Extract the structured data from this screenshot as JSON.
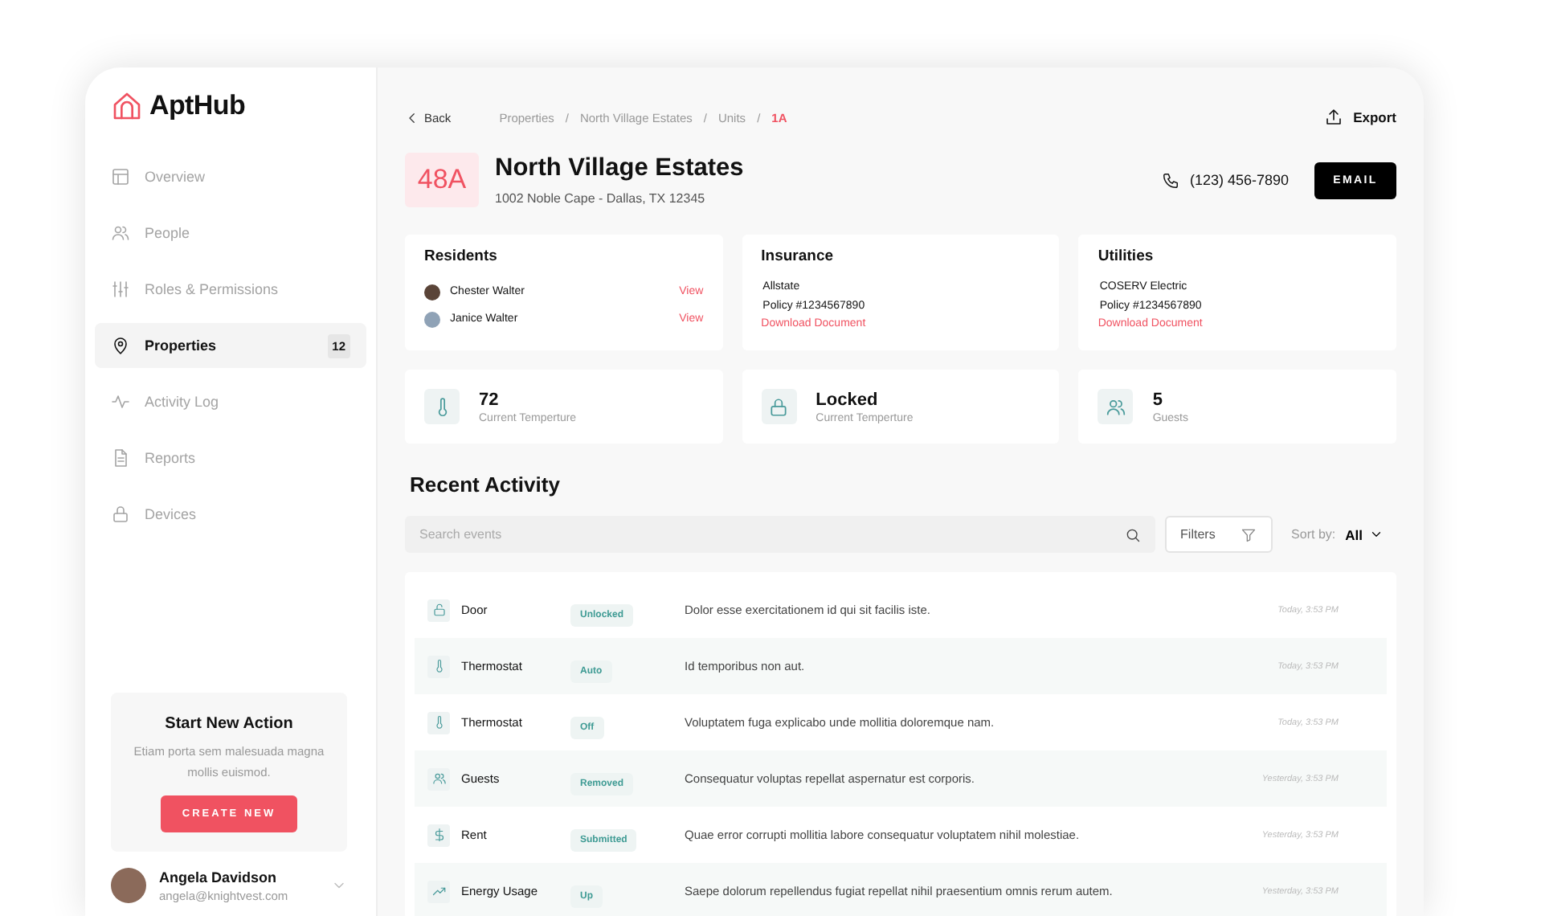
{
  "brand": {
    "name": "AptHub"
  },
  "sidebar": {
    "items": [
      {
        "label": "Overview",
        "kind": "overview",
        "selected": false
      },
      {
        "label": "People",
        "kind": "people",
        "selected": false
      },
      {
        "label": "Roles & Permissions",
        "kind": "roles",
        "selected": false
      },
      {
        "label": "Properties",
        "kind": "properties",
        "selected": true,
        "badge": "12"
      },
      {
        "label": "Activity Log",
        "kind": "activity",
        "selected": false
      },
      {
        "label": "Reports",
        "kind": "reports",
        "selected": false
      },
      {
        "label": "Devices",
        "kind": "devices",
        "selected": false
      }
    ],
    "action_card": {
      "title": "Start New Action",
      "text": "Etiam porta sem malesuada magna mollis euismod.",
      "button": "CREATE NEW"
    },
    "user": {
      "name": "Angela Davidson",
      "email": "angela@knightvest.com"
    }
  },
  "header": {
    "back": "Back",
    "separator": "/",
    "breadcrumbs": [
      {
        "label": "Properties",
        "selected": false
      },
      {
        "label": "North Village Estates",
        "selected": false
      },
      {
        "label": "Units",
        "selected": false
      },
      {
        "label": "1A",
        "selected": true
      }
    ],
    "export": "Export"
  },
  "property": {
    "unit": "48A",
    "title": "North Village Estates",
    "address": "1002 Noble Cape - Dallas, TX 12345",
    "phone": "(123) 456-7890",
    "email_button": "EMAIL"
  },
  "residents": {
    "title": "Residents",
    "items": [
      {
        "name": "Chester Walter",
        "link": "View"
      },
      {
        "name": "Janice Walter",
        "link": "View"
      }
    ]
  },
  "insurance": {
    "title": "Insurance",
    "lines": [
      "Allstate",
      "Policy #1234567890"
    ],
    "link": "Download Document"
  },
  "utilities": {
    "title": "Utilities",
    "lines": [
      "COSERV Electric",
      "Policy #1234567890"
    ],
    "link": "Download Document"
  },
  "stats": [
    {
      "kind": "thermostat",
      "value": "72",
      "label": "Current Temperture"
    },
    {
      "kind": "lock",
      "value": "Locked",
      "label": "Current Temperture"
    },
    {
      "kind": "guests",
      "value": "5",
      "label": "Guests"
    }
  ],
  "activity": {
    "title": "Recent Activity",
    "search_placeholder": "Search events",
    "filters": "Filters",
    "sort_label": "Sort by:",
    "sort_value": "All",
    "rows": [
      {
        "kind": "door",
        "device": "Door",
        "status": "Unlocked",
        "text": "Dolor esse exercitationem id qui sit facilis iste.",
        "time": "Today, 3:53 PM"
      },
      {
        "kind": "thermostat",
        "device": "Thermostat",
        "status": "Auto",
        "text": "Id temporibus non aut.",
        "time": "Today, 3:53 PM"
      },
      {
        "kind": "thermostat",
        "device": "Thermostat",
        "status": "Off",
        "text": "Voluptatem fuga explicabo unde mollitia doloremque nam.",
        "time": "Today, 3:53 PM"
      },
      {
        "kind": "guests",
        "device": "Guests",
        "status": "Removed",
        "text": "Consequatur voluptas repellat aspernatur est corporis.",
        "time": "Yesterday, 3:53 PM"
      },
      {
        "kind": "rent",
        "device": "Rent",
        "status": "Submitted",
        "text": "Quae error corrupti mollitia labore consequatur voluptatem nihil molestiae.",
        "time": "Yesterday, 3:53 PM"
      },
      {
        "kind": "energy",
        "device": "Energy Usage",
        "status": "Up",
        "text": "Saepe dolorum repellendus fugiat repellat nihil praesentium omnis rerum autem.",
        "time": "Yesterday, 3:53 PM"
      }
    ]
  }
}
